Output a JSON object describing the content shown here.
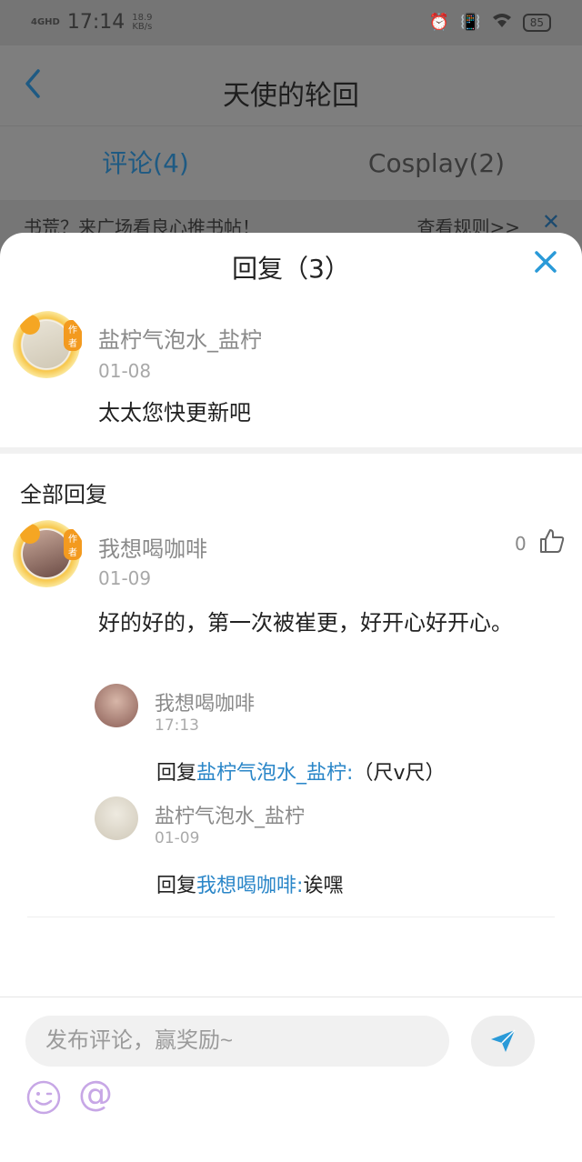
{
  "status_bar": {
    "signal": "4GHD",
    "time": "17:14",
    "speed": "18.9",
    "speed_unit": "KB/s",
    "battery": "85"
  },
  "nav": {
    "title": "天使的轮回"
  },
  "tabs": [
    {
      "label": "评论(4)",
      "active": true
    },
    {
      "label": "Cosplay(2)",
      "active": false
    }
  ],
  "banner": {
    "text": "书荒？来广场看良心推书帖！",
    "link": "查看规则>>"
  },
  "sheet": {
    "title": "回复（3）",
    "main_comment": {
      "author": "盐柠气泡水_盐柠",
      "badge": "作者",
      "date": "01-08",
      "text": "太太您快更新吧"
    },
    "all_replies_label": "全部回复",
    "reply": {
      "author": "我想喝咖啡",
      "badge": "作者",
      "date": "01-09",
      "likes": "0",
      "text": "好的好的，第一次被崔更，好开心好开心。",
      "sub_replies": [
        {
          "author": "我想喝咖啡",
          "time": "17:13",
          "prefix": "回复",
          "target": "盐柠气泡水_盐柠:",
          "text": "（尺v尺）"
        },
        {
          "author": "盐柠气泡水_盐柠",
          "time": "01-09",
          "prefix": "回复",
          "target": "我想喝咖啡:",
          "text": "诶嘿"
        }
      ]
    }
  },
  "compose": {
    "placeholder": "发布评论，赢奖励~"
  },
  "colors": {
    "link": "#2a86c8",
    "accent": "#2a9ad8"
  }
}
